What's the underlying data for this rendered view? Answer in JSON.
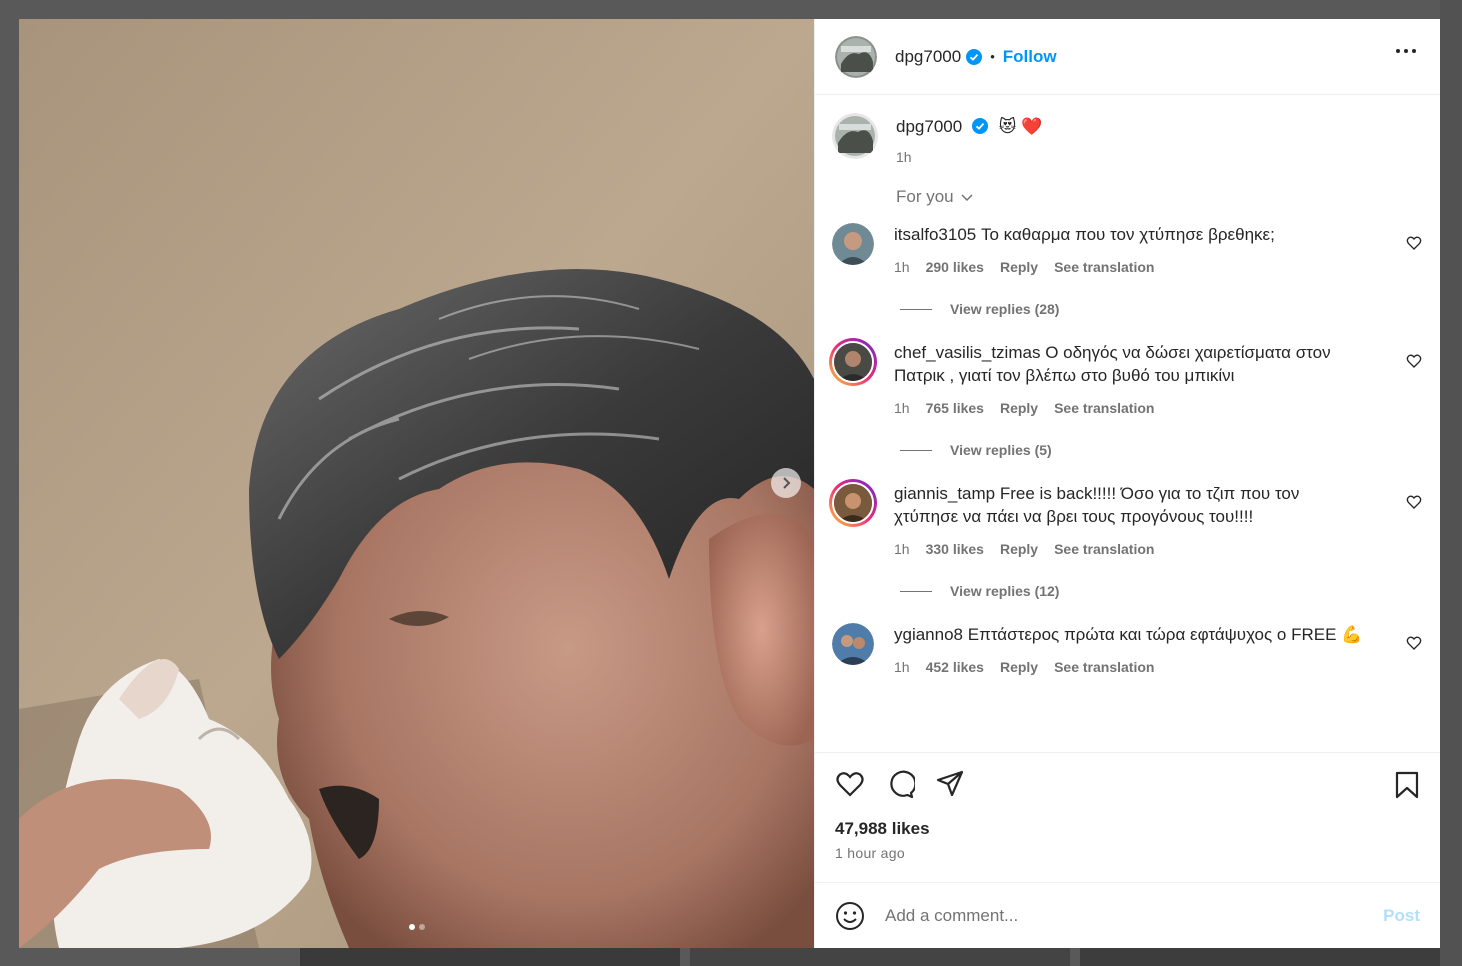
{
  "header": {
    "username": "dpg7000",
    "separator": "•",
    "follow_label": "Follow"
  },
  "caption": {
    "username": "dpg7000",
    "text": "😻 ❤️",
    "time": "1h"
  },
  "sort": {
    "label": "For you"
  },
  "comments": [
    {
      "username": "itsalfo3105",
      "text": "Το καθαρμα που τον χτύπησε βρεθηκε;",
      "time": "1h",
      "likes": "290 likes",
      "reply_label": "Reply",
      "translate_label": "See translation",
      "view_replies": "View replies (28)"
    },
    {
      "username": "chef_vasilis_tzimas",
      "text": "Ο οδηγός να δώσει χαιρετίσματα στον Πατρικ , γιατί τον βλέπω στο βυθό του μπικίνι",
      "time": "1h",
      "likes": "765 likes",
      "reply_label": "Reply",
      "translate_label": "See translation",
      "view_replies": "View replies (5)"
    },
    {
      "username": "giannis_tamp",
      "text": "Free is back!!!!! Όσο για το τζιπ που τον χτύπησε να πάει να βρει τους προγόνους του!!!!",
      "time": "1h",
      "likes": "330 likes",
      "reply_label": "Reply",
      "translate_label": "See translation",
      "view_replies": "View replies (12)"
    },
    {
      "username": "ygianno8",
      "text": "Επτάστερος πρώτα και τώρα εφτάψυχος ο FREE 💪",
      "time": "1h",
      "likes": "452 likes",
      "reply_label": "Reply",
      "translate_label": "See translation"
    }
  ],
  "post": {
    "likes": "47,988 likes",
    "posted": "1 hour ago"
  },
  "add_comment": {
    "placeholder": "Add a comment...",
    "post_label": "Post"
  },
  "icons": {
    "verified": "verified-badge-icon",
    "more": "more-options-icon",
    "like": "heart-icon",
    "comment": "comment-icon",
    "share": "share-icon",
    "save": "bookmark-icon",
    "emoji": "emoji-icon",
    "carousel": "chevron-right-icon"
  },
  "colors": {
    "accent": "#0095f6",
    "muted": "#737373",
    "post_disabled": "#b2dffc"
  },
  "carousel": {
    "slides": 2,
    "current": 1
  }
}
